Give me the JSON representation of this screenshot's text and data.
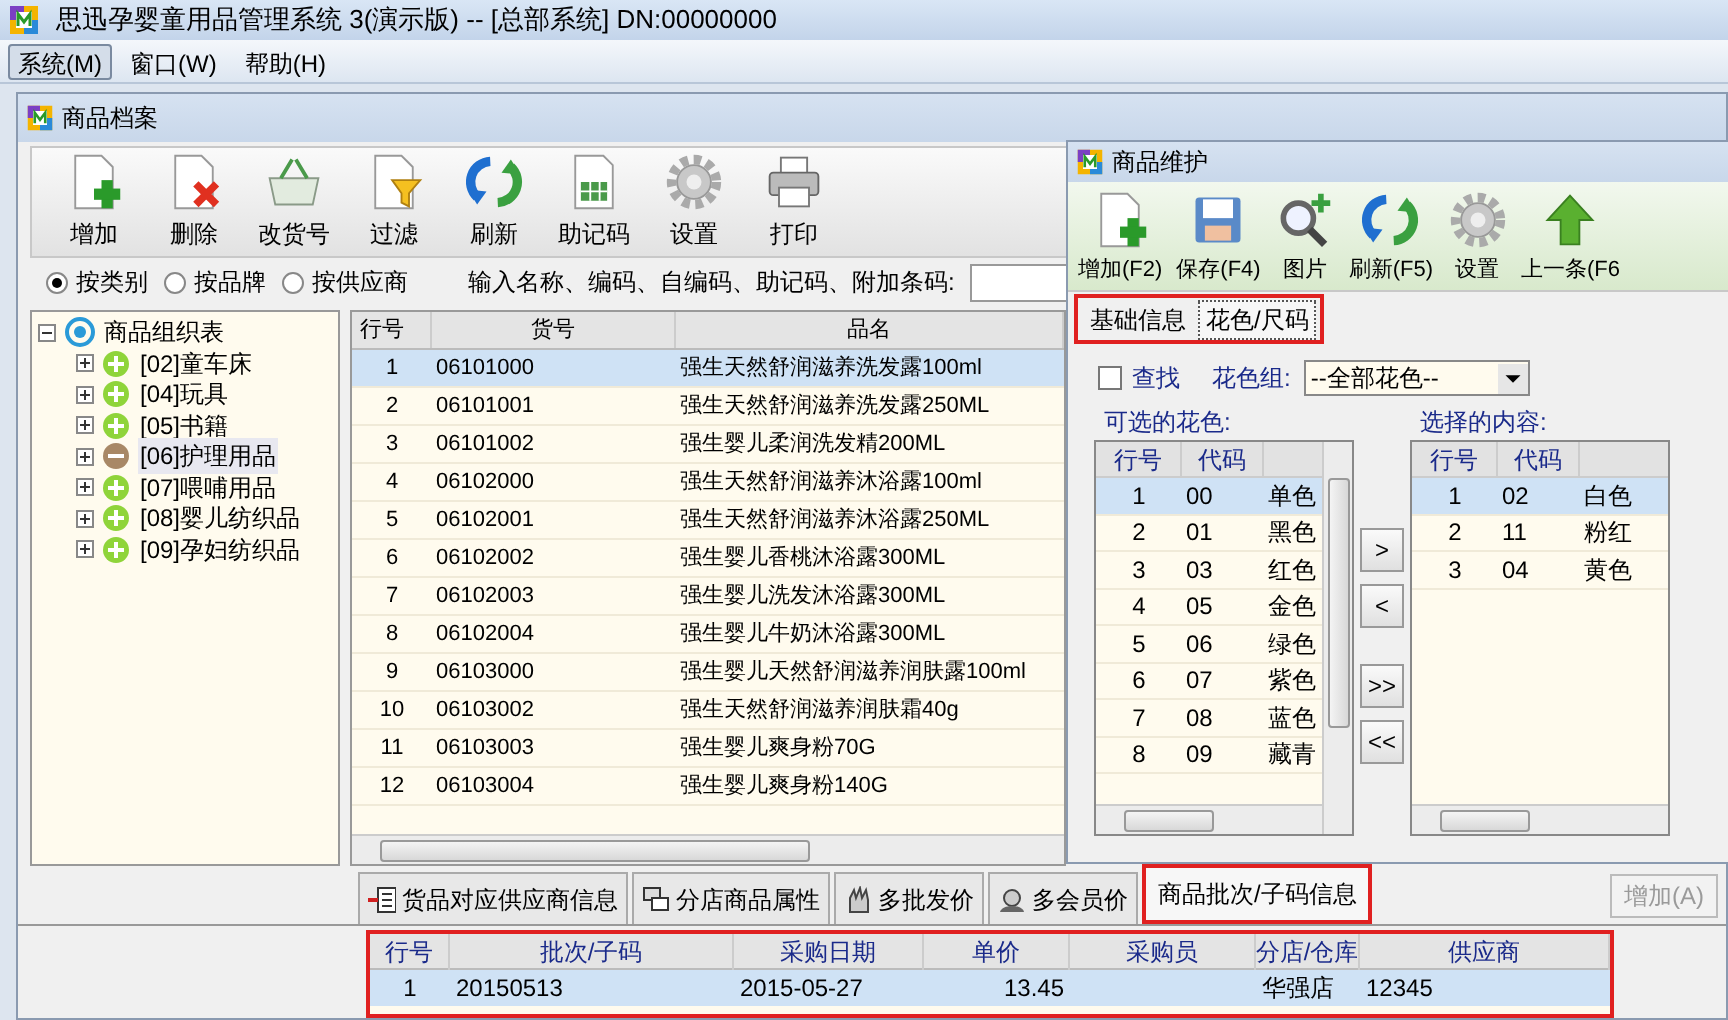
{
  "window": {
    "title": "思迅孕婴童用品管理系统 3(演示版) -- [总部系统] DN:00000000"
  },
  "menu": [
    {
      "label": "系统(M)",
      "selected": true
    },
    {
      "label": "窗口(W)",
      "selected": false
    },
    {
      "label": "帮助(H)",
      "selected": false
    }
  ],
  "archive_window": {
    "title": "商品档案",
    "toolbar": [
      "增加",
      "删除",
      "改货号",
      "过滤",
      "刷新",
      "助记码",
      "设置",
      "打印"
    ],
    "filter_options": [
      {
        "label": "按类别",
        "selected": true
      },
      {
        "label": "按品牌",
        "selected": false
      },
      {
        "label": "按供应商",
        "selected": false
      }
    ],
    "search_label": "输入名称、编码、自编码、助记码、附加条码:",
    "tree": {
      "label": "商品组织表",
      "expanded": true,
      "children": [
        {
          "label": "[02]童车床",
          "selected": false
        },
        {
          "label": "[04]玩具",
          "selected": false
        },
        {
          "label": "[05]书籍",
          "selected": false
        },
        {
          "label": "[06]护理用品",
          "selected": true
        },
        {
          "label": "[07]喂哺用品",
          "selected": false
        },
        {
          "label": "[08]婴儿纺织品",
          "selected": false
        },
        {
          "label": "[09]孕妇纺织品",
          "selected": false
        }
      ]
    },
    "goods_table": {
      "columns": [
        "行号",
        "货号",
        "品名"
      ],
      "rows": [
        {
          "cells": [
            "1",
            "06101000",
            "强生天然舒润滋养洗发露100ml"
          ],
          "selected": true
        },
        {
          "cells": [
            "2",
            "06101001",
            "强生天然舒润滋养洗发露250ML"
          ],
          "selected": false
        },
        {
          "cells": [
            "3",
            "06101002",
            "强生婴儿柔润洗发精200ML"
          ],
          "selected": false
        },
        {
          "cells": [
            "4",
            "06102000",
            "强生天然舒润滋养沐浴露100ml"
          ],
          "selected": false
        },
        {
          "cells": [
            "5",
            "06102001",
            "强生天然舒润滋养沐浴露250ML"
          ],
          "selected": false
        },
        {
          "cells": [
            "6",
            "06102002",
            "强生婴儿香桃沐浴露300ML"
          ],
          "selected": false
        },
        {
          "cells": [
            "7",
            "06102003",
            "强生婴儿洗发沐浴露300ML"
          ],
          "selected": false
        },
        {
          "cells": [
            "8",
            "06102004",
            "强生婴儿牛奶沐浴露300ML"
          ],
          "selected": false
        },
        {
          "cells": [
            "9",
            "06103000",
            "强生婴儿天然舒润滋养润肤露100ml"
          ],
          "selected": false
        },
        {
          "cells": [
            "10",
            "06103002",
            "强生天然舒润滋养润肤霜40g"
          ],
          "selected": false
        },
        {
          "cells": [
            "11",
            "06103003",
            "强生婴儿爽身粉70G"
          ],
          "selected": false
        },
        {
          "cells": [
            "12",
            "06103004",
            "强生婴儿爽身粉140G"
          ],
          "selected": false
        }
      ]
    },
    "detail_tabs": [
      {
        "label": "货品对应供应商信息",
        "selected": false
      },
      {
        "label": "分店商品属性",
        "selected": false
      },
      {
        "label": "多批发价",
        "selected": false
      },
      {
        "label": "多会员价",
        "selected": false
      },
      {
        "label": "商品批次/子码信息",
        "selected": true
      }
    ],
    "add_button": {
      "label": "增加(A)",
      "disabled": true
    },
    "batch_table": {
      "columns": [
        "行号",
        "批次/子码",
        "采购日期",
        "单价",
        "采购员",
        "分店/仓库",
        "供应商"
      ],
      "rows": [
        {
          "cells": [
            "1",
            "20150513",
            "2015-05-27",
            "13.45",
            null,
            "华强店",
            "12345"
          ],
          "selected": true
        }
      ]
    }
  },
  "maintenance_window": {
    "title": "商品维护",
    "toolbar": [
      "增加(F2)",
      "保存(F4)",
      "图片",
      "刷新(F5)",
      "设置",
      "上一条(F6"
    ],
    "tabs": [
      {
        "label": "基础信息",
        "selected": false
      },
      {
        "label": "花色/尺码",
        "selected": true
      }
    ],
    "find": {
      "label": "查找",
      "checked": false
    },
    "color_group": {
      "label": "花色组:",
      "value": "--全部花色--"
    },
    "available": {
      "label": "可选的花色:",
      "columns": [
        "行号",
        "代码"
      ],
      "rows": [
        {
          "cells": [
            "1",
            "00",
            "单色"
          ],
          "selected": true
        },
        {
          "cells": [
            "2",
            "01",
            "黑色"
          ],
          "selected": false
        },
        {
          "cells": [
            "3",
            "03",
            "红色"
          ],
          "selected": false
        },
        {
          "cells": [
            "4",
            "05",
            "金色"
          ],
          "selected": false
        },
        {
          "cells": [
            "5",
            "06",
            "绿色"
          ],
          "selected": false
        },
        {
          "cells": [
            "6",
            "07",
            "紫色"
          ],
          "selected": false
        },
        {
          "cells": [
            "7",
            "08",
            "蓝色"
          ],
          "selected": false
        },
        {
          "cells": [
            "8",
            "09",
            "藏青"
          ],
          "selected": false
        }
      ]
    },
    "transfer_buttons": [
      ">",
      "<",
      ">>",
      "<<"
    ],
    "chosen": {
      "label": "选择的内容:",
      "columns": [
        "行号",
        "代码"
      ],
      "rows": [
        {
          "cells": [
            "1",
            "02",
            "白色"
          ],
          "selected": true
        },
        {
          "cells": [
            "2",
            "11",
            "粉红"
          ],
          "selected": false
        },
        {
          "cells": [
            "3",
            "04",
            "黄色"
          ],
          "selected": false
        }
      ]
    }
  }
}
